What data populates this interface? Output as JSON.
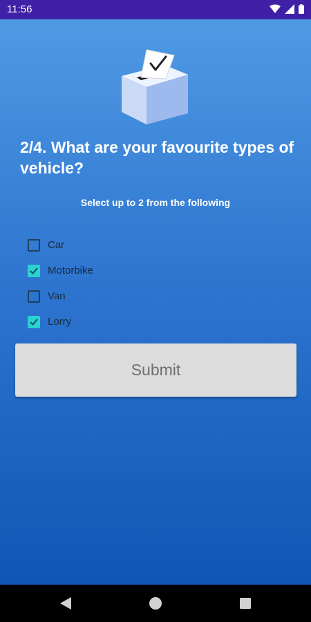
{
  "status_bar": {
    "time": "11:56"
  },
  "survey": {
    "question": "2/4. What are your favourite types of vehicle?",
    "instruction": "Select up to 2 from the following",
    "options": [
      {
        "label": "Car",
        "checked": false
      },
      {
        "label": "Motorbike",
        "checked": true
      },
      {
        "label": "Van",
        "checked": false
      },
      {
        "label": "Lorry",
        "checked": true
      }
    ],
    "submit_label": "Submit"
  },
  "colors": {
    "status_bar": "#3f20a6",
    "checkbox_checked": "#28d3cf",
    "submit_bg": "#dcdcdc",
    "nav_bar": "#000000"
  },
  "icons": {
    "status": [
      "wifi-icon",
      "signal-icon",
      "battery-icon"
    ],
    "illustration": "ballot-box-icon",
    "nav": [
      "back-icon",
      "home-icon",
      "recents-icon"
    ]
  }
}
